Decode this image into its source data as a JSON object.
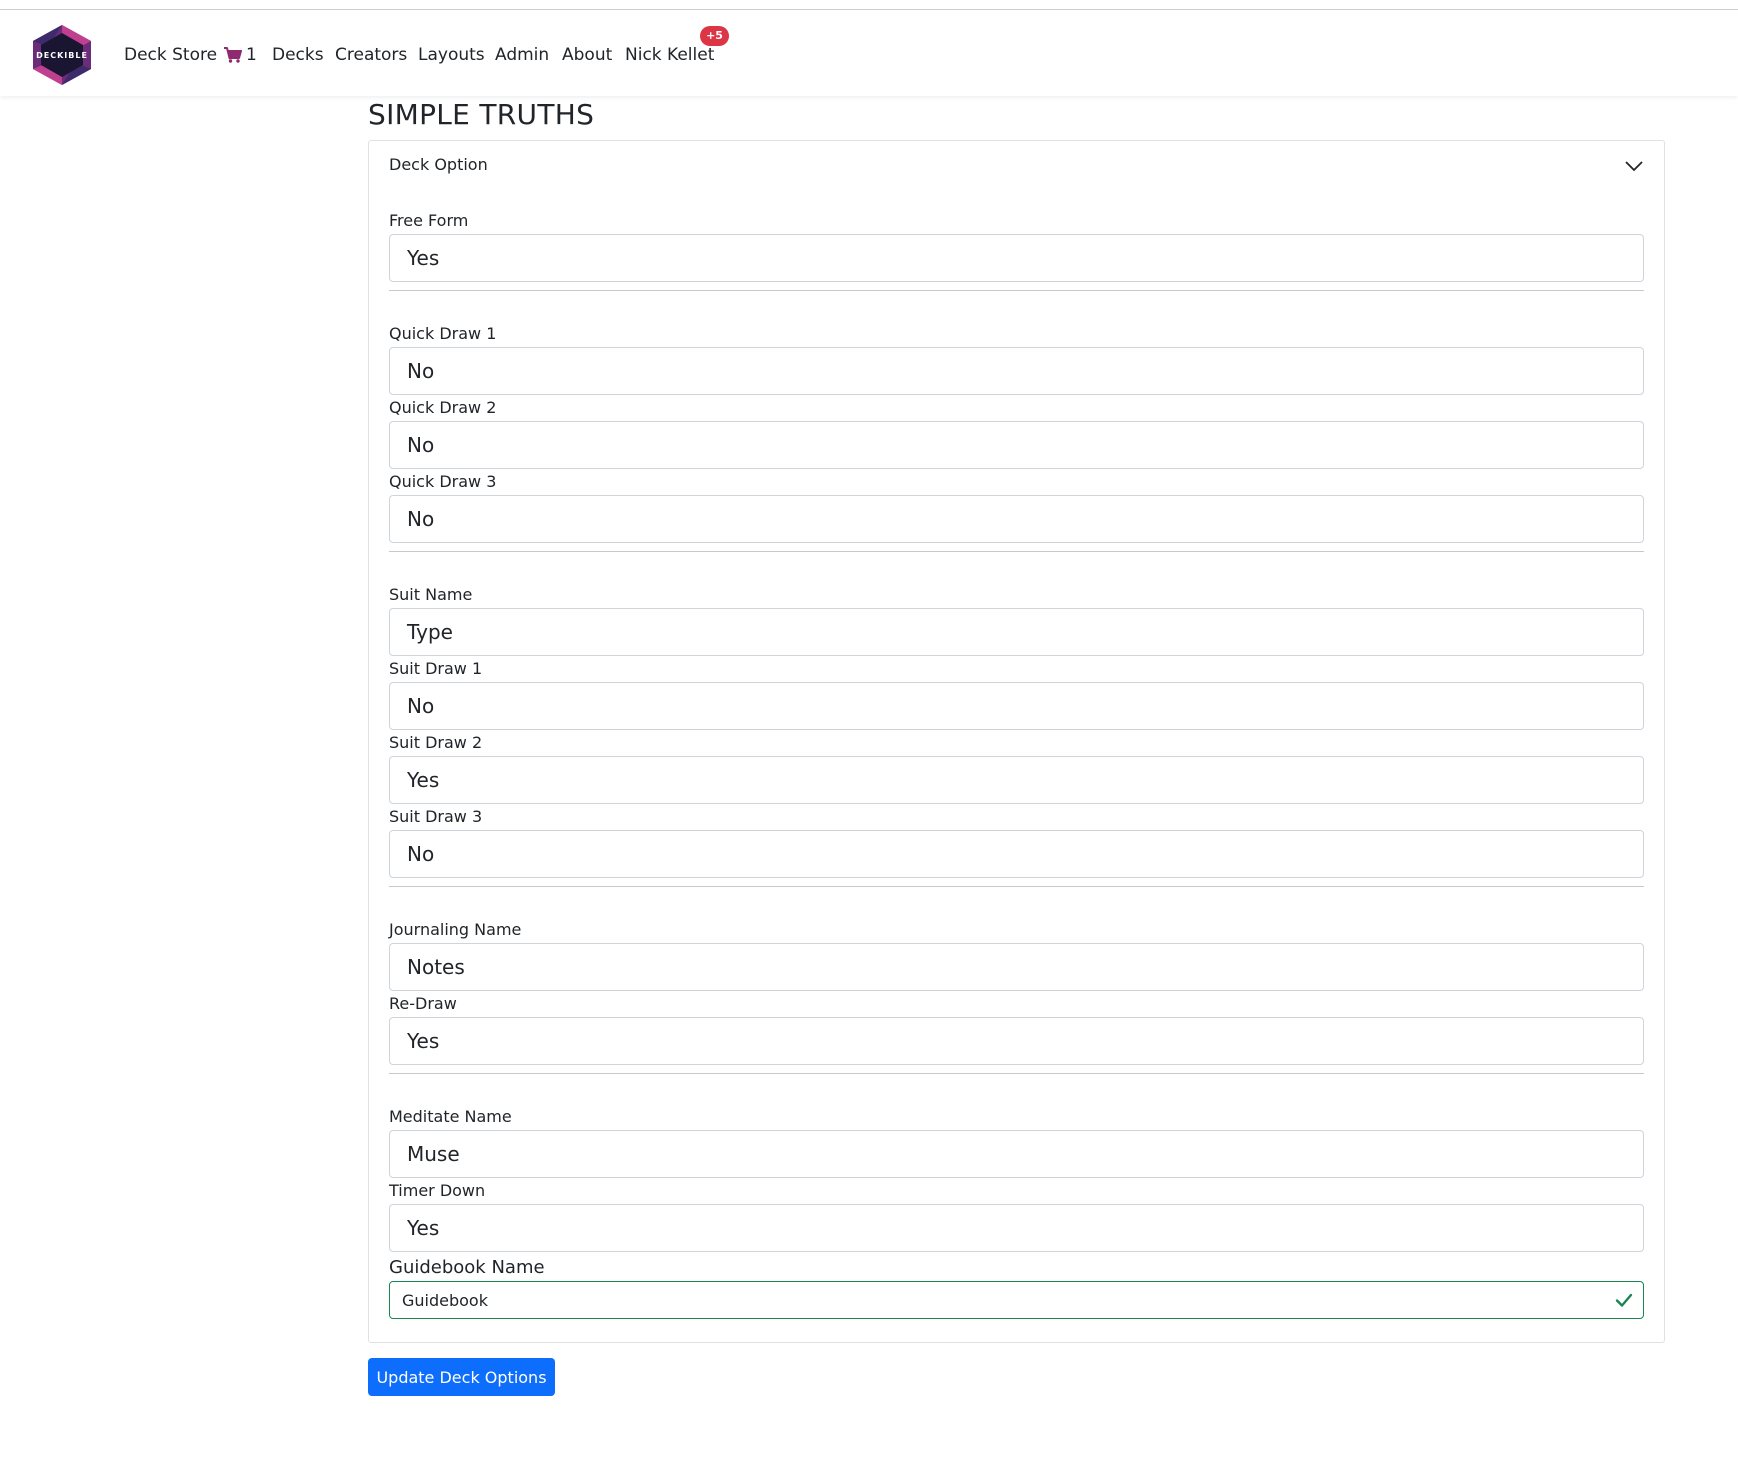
{
  "brand": {
    "logo_text": "DECKIBLE"
  },
  "nav": {
    "deck_store": "Deck Store",
    "cart_count": "1",
    "decks": "Decks",
    "creators": "Creators",
    "layouts": "Layouts",
    "admin": "Admin",
    "about": "About",
    "user": "Nick Kellet",
    "notification_badge": "+5"
  },
  "colors": {
    "accent": "#0d6efd",
    "cart": "#8e2a6f",
    "badge": "#dc3545",
    "valid": "#198754"
  },
  "page": {
    "title": "SIMPLE TRUTHS"
  },
  "card": {
    "header": "Deck Option"
  },
  "fields": {
    "free_form": {
      "label": "Free Form",
      "value": "Yes"
    },
    "quick_draw_1": {
      "label": "Quick Draw 1",
      "value": "No"
    },
    "quick_draw_2": {
      "label": "Quick Draw 2",
      "value": "No"
    },
    "quick_draw_3": {
      "label": "Quick Draw 3",
      "value": "No"
    },
    "suit_name": {
      "label": "Suit Name",
      "value": "Type"
    },
    "suit_draw_1": {
      "label": "Suit Draw 1",
      "value": "No"
    },
    "suit_draw_2": {
      "label": "Suit Draw 2",
      "value": "Yes"
    },
    "suit_draw_3": {
      "label": "Suit Draw 3",
      "value": "No"
    },
    "journaling_name": {
      "label": "Journaling Name",
      "value": "Notes"
    },
    "re_draw": {
      "label": "Re-Draw",
      "value": "Yes"
    },
    "meditate_name": {
      "label": "Meditate Name",
      "value": "Muse"
    },
    "timer_down": {
      "label": "Timer Down",
      "value": "Yes"
    },
    "guidebook_name": {
      "label": "Guidebook Name",
      "value": "Guidebook"
    }
  },
  "actions": {
    "update_label": "Update Deck Options"
  }
}
